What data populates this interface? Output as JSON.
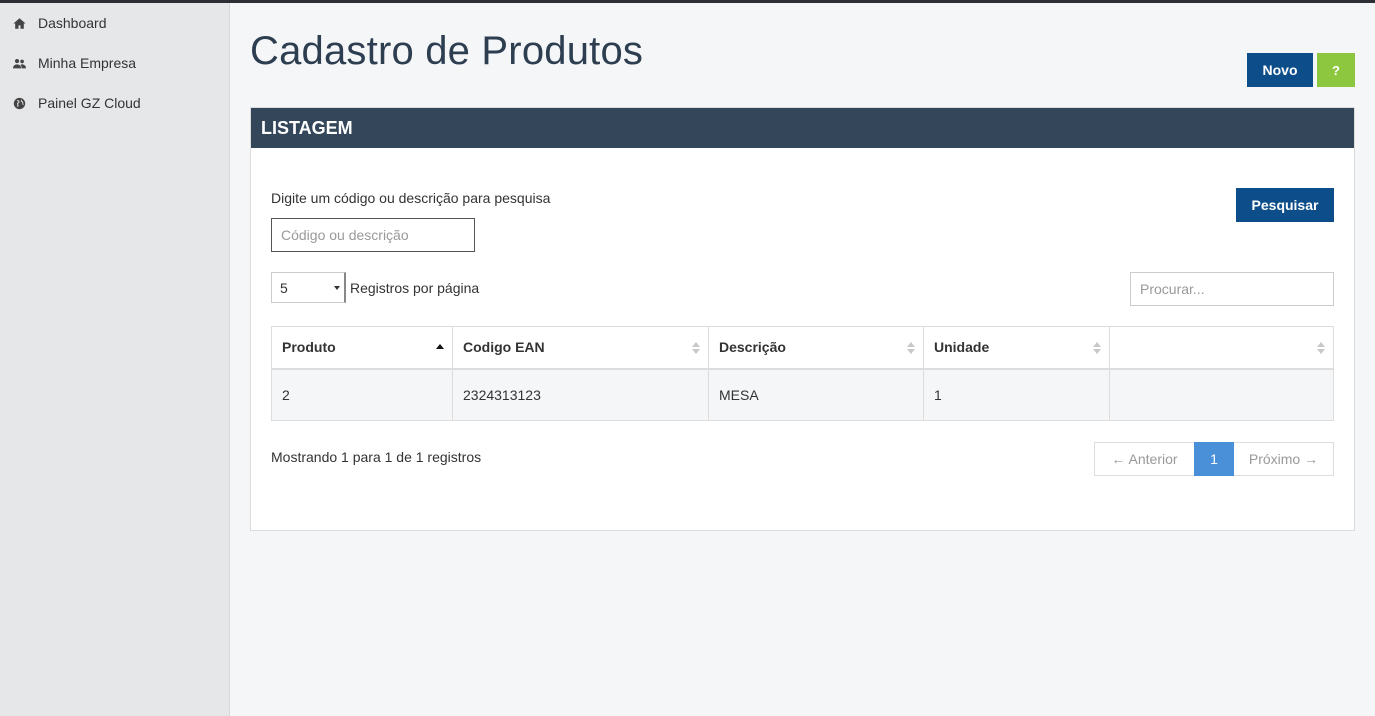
{
  "sidebar": {
    "items": [
      {
        "label": "Dashboard",
        "icon": "home-icon"
      },
      {
        "label": "Minha Empresa",
        "icon": "users-icon"
      },
      {
        "label": "Painel GZ Cloud",
        "icon": "globe-icon"
      }
    ]
  },
  "header": {
    "title": "Cadastro de Produtos",
    "new_button": "Novo",
    "help_button": "?"
  },
  "panel": {
    "heading": "LISTAGEM",
    "search_label": "Digite um código ou descrição para pesquisa",
    "search_placeholder": "Código ou descrição",
    "search_button": "Pesquisar",
    "page_length": "5",
    "page_length_label": "Registros por página",
    "filter_placeholder": "Procurar..."
  },
  "table": {
    "columns": [
      "Produto",
      "Codigo EAN",
      "Descrição",
      "Unidade",
      ""
    ],
    "rows": [
      [
        "2",
        "2324313123",
        "MESA",
        "1",
        ""
      ]
    ]
  },
  "footer": {
    "info": "Mostrando 1 para 1 de 1 registros",
    "prev": "← Anterior",
    "current_page": "1",
    "next": "Próximo →"
  },
  "colors": {
    "primary": "#0d4e8a",
    "help": "#8dc63f",
    "panel_heading": "#344659",
    "active_page": "#4a90d9"
  }
}
